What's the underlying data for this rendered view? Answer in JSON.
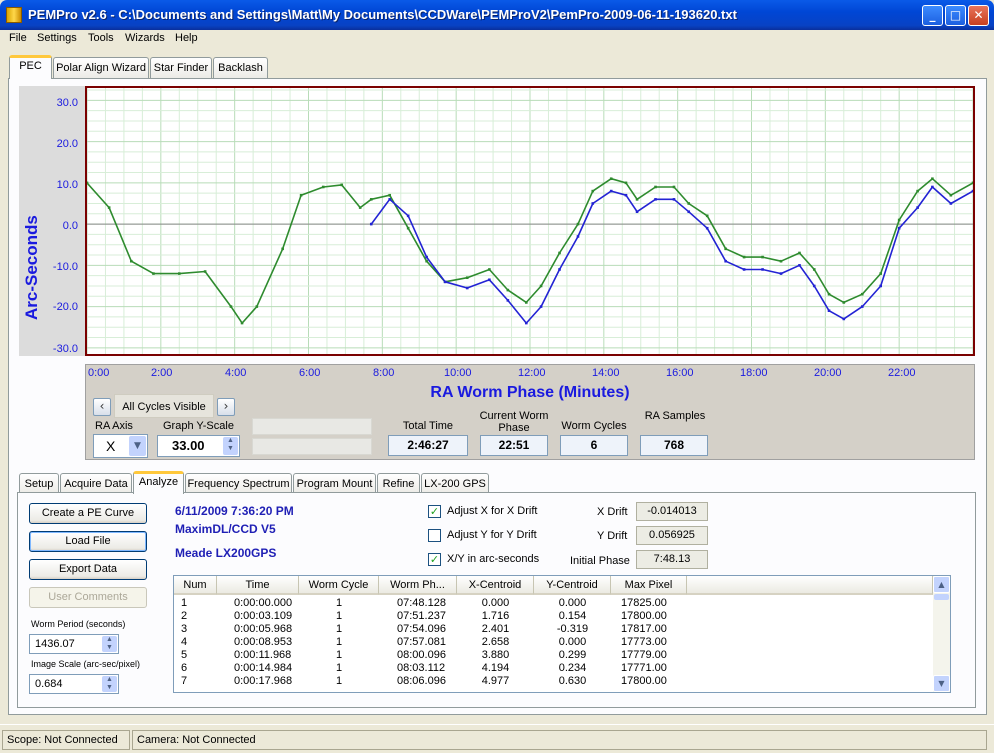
{
  "window": {
    "title": "PEMPro v2.6 - C:\\Documents and Settings\\Matt\\My Documents\\CCDWare\\PEMProV2\\PemPro-2009-06-11-193620.txt",
    "minimize": "_",
    "maximize": "□",
    "close": "✕"
  },
  "menu": [
    "File",
    "Settings",
    "Tools",
    "Wizards",
    "Help"
  ],
  "main_tabs": [
    "PEC",
    "Polar Align Wizard",
    "Star Finder",
    "Backlash"
  ],
  "chart_data": {
    "type": "line",
    "title": "",
    "xlabel": "RA Worm Phase (Minutes)",
    "ylabel": "Arc-Seconds",
    "xlim": [
      0,
      24
    ],
    "ylim": [
      -31.5,
      33
    ],
    "x_tick_labels": [
      "0:00",
      "2:00",
      "4:00",
      "6:00",
      "8:00",
      "10:00",
      "12:00",
      "14:00",
      "16:00",
      "18:00",
      "20:00",
      "22:00"
    ],
    "y_tick_labels": [
      "30.0",
      "20.0",
      "10.0",
      "0.0",
      "-10.0",
      "-20.0",
      "-30.0"
    ],
    "grid": true,
    "series": [
      {
        "color": "#2e8b2e",
        "x": [
          0,
          0.6,
          1.2,
          1.8,
          2.5,
          3.2,
          3.9,
          4.2,
          4.6,
          5.3,
          5.8,
          6.4,
          6.9,
          7.4,
          7.7,
          8.2,
          8.7,
          9.2,
          9.7,
          10.3,
          10.9,
          11.4,
          11.9,
          12.3,
          12.8,
          13.3,
          13.7,
          14.2,
          14.6,
          14.9,
          15.4,
          15.9,
          16.3,
          16.8,
          17.3,
          17.8,
          18.3,
          18.8,
          19.3,
          19.7,
          20.1,
          20.5,
          21.0,
          21.5,
          22.0,
          22.5,
          22.9,
          23.4,
          24.0
        ],
        "values": [
          10,
          4,
          -9,
          -12,
          -12,
          -11.5,
          -20,
          -24,
          -20,
          -6,
          7,
          9,
          9.5,
          4,
          6,
          7,
          -1,
          -9,
          -14,
          -13,
          -11,
          -16,
          -19,
          -15,
          -7,
          0,
          8,
          11,
          10,
          6,
          9,
          9,
          5,
          2,
          -6,
          -8,
          -8,
          -9,
          -7,
          -11,
          -17,
          -19,
          -17,
          -12,
          1,
          8,
          11,
          7,
          10
        ]
      },
      {
        "color": "#2323d4",
        "x": [
          7.7,
          8.2,
          8.7,
          9.2,
          9.7,
          10.3,
          10.9,
          11.4,
          11.9,
          12.3,
          12.8,
          13.3,
          13.7,
          14.2,
          14.6,
          14.9,
          15.4,
          15.9,
          16.3,
          16.8,
          17.3,
          17.8,
          18.3,
          18.8,
          19.3,
          19.7,
          20.1,
          20.5,
          21.0,
          21.5,
          22.0,
          22.5,
          22.9,
          23.4,
          24.0
        ],
        "values": [
          0,
          6,
          2,
          -8,
          -14,
          -15.5,
          -13.5,
          -18.5,
          -24,
          -20,
          -11,
          -3,
          5,
          8,
          7,
          3,
          6,
          6,
          3,
          -1,
          -9,
          -11,
          -11,
          -12,
          -10,
          -15,
          -21,
          -23,
          -20,
          -15,
          -1,
          4,
          9,
          5,
          8
        ]
      }
    ]
  },
  "nav": {
    "prev": "‹",
    "label": "All Cycles Visible",
    "next": "›"
  },
  "ra_axis": {
    "label": "RA Axis",
    "value": "X"
  },
  "graph_yscale": {
    "label": "Graph Y-Scale",
    "value": "33.00"
  },
  "stats": [
    {
      "label": "Total Time",
      "value": "2:46:27"
    },
    {
      "label": "Current Worm Phase",
      "value": "22:51"
    },
    {
      "label": "Worm Cycles",
      "value": "6"
    },
    {
      "label": "RA Samples",
      "value": "768"
    }
  ],
  "sub_tabs": [
    "Setup",
    "Acquire Data",
    "Analyze",
    "Frequency Spectrum",
    "Program Mount",
    "Refine",
    "LX-200 GPS"
  ],
  "buttons": {
    "create": "Create a PE Curve",
    "load": "Load File",
    "export": "Export Data",
    "comments": "User Comments"
  },
  "worm_period": {
    "label": "Worm Period (seconds)",
    "value": "1436.07"
  },
  "image_scale": {
    "label": "Image Scale (arc-sec/pixel)",
    "value": "0.684"
  },
  "info": {
    "datetime": "6/11/2009 7:36:20 PM",
    "camera": "MaximDL/CCD V5",
    "mount": "Meade LX200GPS"
  },
  "options": [
    {
      "label": "Adjust X for X Drift",
      "checked": true
    },
    {
      "label": "Adjust Y for Y Drift",
      "checked": false
    },
    {
      "label": "X/Y in arc-seconds",
      "checked": true
    }
  ],
  "drift": {
    "x_label": "X Drift",
    "x_value": "-0.014013",
    "y_label": "Y Drift",
    "y_value": "0.056925",
    "phase_label": "Initial Phase",
    "phase_value": "7:48.13"
  },
  "table": {
    "columns": [
      "Num",
      "Time",
      "Worm Cycle",
      "Worm Ph...",
      "X-Centroid",
      "Y-Centroid",
      "Max Pixel"
    ],
    "rows": [
      [
        "1",
        "0:00:00.000",
        "1",
        "07:48.128",
        "0.000",
        "0.000",
        "17825.00"
      ],
      [
        "2",
        "0:00:03.109",
        "1",
        "07:51.237",
        "1.716",
        "0.154",
        "17800.00"
      ],
      [
        "3",
        "0:00:05.968",
        "1",
        "07:54.096",
        "2.401",
        "-0.319",
        "17817.00"
      ],
      [
        "4",
        "0:00:08.953",
        "1",
        "07:57.081",
        "2.658",
        "0.000",
        "17773.00"
      ],
      [
        "5",
        "0:00:11.968",
        "1",
        "08:00.096",
        "3.880",
        "0.299",
        "17779.00"
      ],
      [
        "6",
        "0:00:14.984",
        "1",
        "08:03.112",
        "4.194",
        "0.234",
        "17771.00"
      ],
      [
        "7",
        "0:00:17.968",
        "1",
        "08:06.096",
        "4.977",
        "0.630",
        "17800.00"
      ]
    ]
  },
  "status": {
    "scope": "Scope: Not Connected",
    "camera": "Camera: Not Connected"
  }
}
